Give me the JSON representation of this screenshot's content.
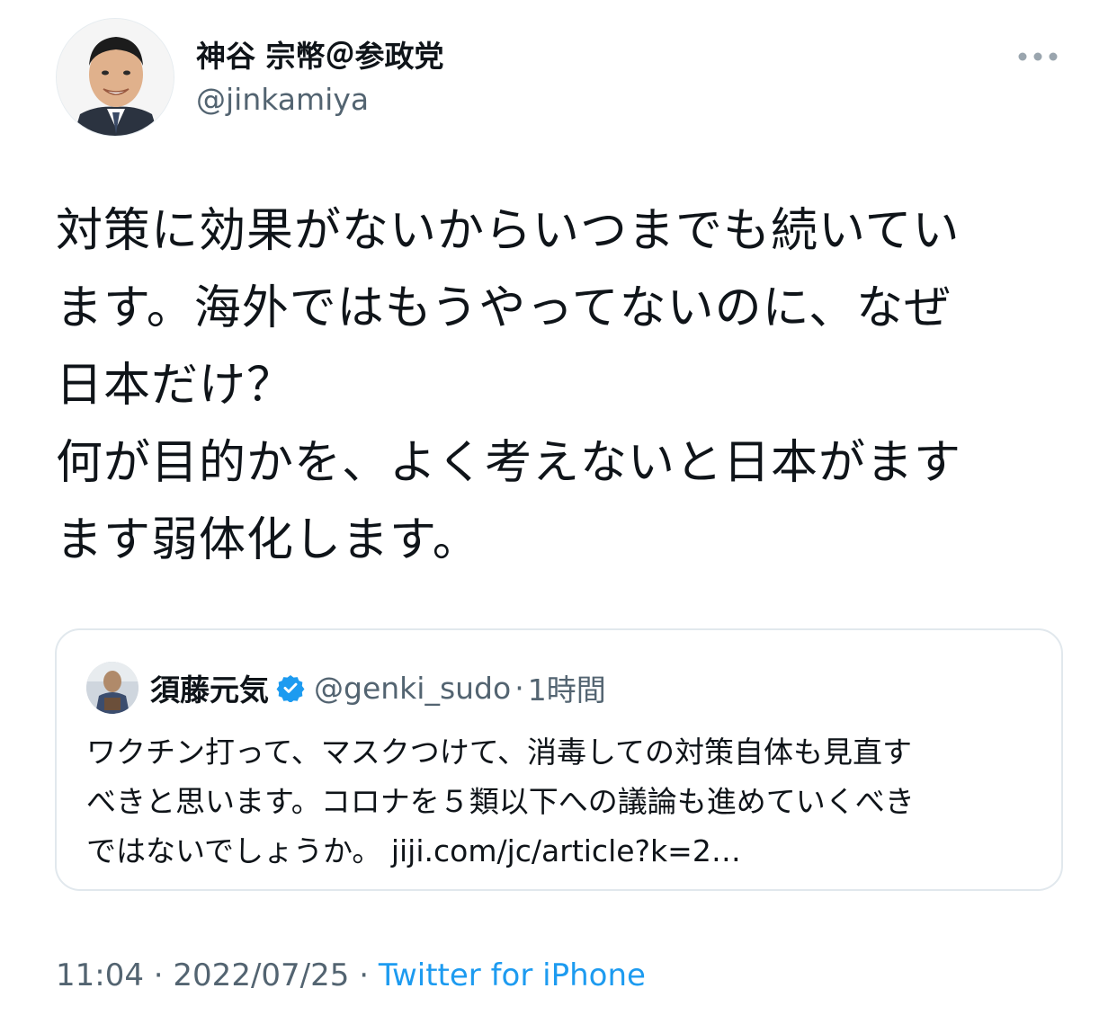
{
  "tweet": {
    "display_name": "神谷 宗幣＠参政党",
    "handle": "@jinkamiya",
    "more_icon": "ellipsis-icon",
    "text": "対策に効果がないからいつまでも続いてい\nます。海外ではもうやってないのに、なぜ\n日本だけ？\n何が目的かを、よく考えないと日本がます\nます弱体化します。",
    "time": "11:04",
    "date": "2022/07/25",
    "separator": "·",
    "source": "Twitter for iPhone"
  },
  "quote": {
    "name": "須藤元気",
    "verified_icon": "verified-badge-icon",
    "handle": "@genki_sudo",
    "separator": "·",
    "time": "1時間",
    "text": "ワクチン打って、マスクつけて、消毒しての対策自体も見直す\nべきと思います。コロナを５類以下への議論も進めていくべき\nではないでしょうか。 ",
    "link": "jiji.com/jc/article?k=2…"
  },
  "colors": {
    "text": "#0f1419",
    "secondary": "#536471",
    "link": "#1d9bf0",
    "border": "#e1e8ed",
    "verified": "#1d9bf0"
  }
}
